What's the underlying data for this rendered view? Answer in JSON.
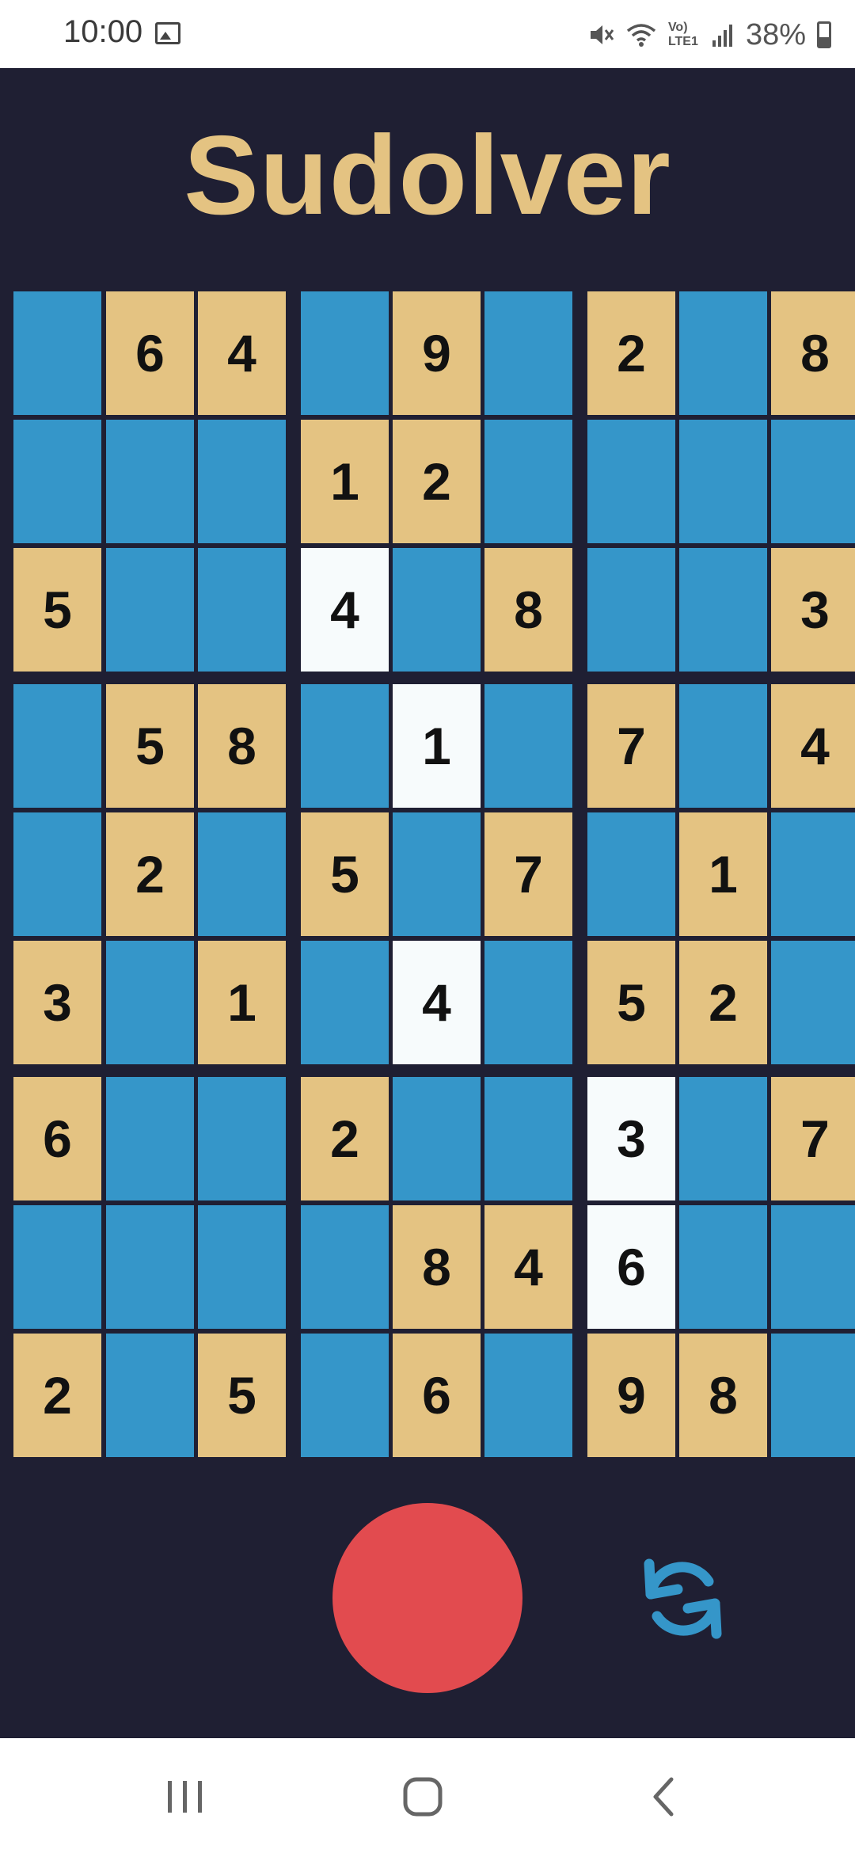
{
  "status_bar": {
    "time": "10:00",
    "network_label": "Vo) LTE1",
    "battery": "38%"
  },
  "app": {
    "title": "Sudolver"
  },
  "colors": {
    "background": "#1f1f33",
    "title": "#e4c382",
    "cell_empty": "#3596c9",
    "cell_given": "#e4c382",
    "cell_highlight": "#f7fbfc",
    "record_button": "#e24b4f",
    "refresh_icon": "#3596c9"
  },
  "board": {
    "rows": [
      [
        {
          "v": "",
          "s": "blue"
        },
        {
          "v": "6",
          "s": "tan"
        },
        {
          "v": "4",
          "s": "tan"
        },
        {
          "v": "",
          "s": "blue"
        },
        {
          "v": "9",
          "s": "tan"
        },
        {
          "v": "",
          "s": "blue"
        },
        {
          "v": "2",
          "s": "tan"
        },
        {
          "v": "",
          "s": "blue"
        },
        {
          "v": "8",
          "s": "tan"
        }
      ],
      [
        {
          "v": "",
          "s": "blue"
        },
        {
          "v": "",
          "s": "blue"
        },
        {
          "v": "",
          "s": "blue"
        },
        {
          "v": "1",
          "s": "tan"
        },
        {
          "v": "2",
          "s": "tan"
        },
        {
          "v": "",
          "s": "blue"
        },
        {
          "v": "",
          "s": "blue"
        },
        {
          "v": "",
          "s": "blue"
        },
        {
          "v": "",
          "s": "blue"
        }
      ],
      [
        {
          "v": "5",
          "s": "tan"
        },
        {
          "v": "",
          "s": "blue"
        },
        {
          "v": "",
          "s": "blue"
        },
        {
          "v": "4",
          "s": "white"
        },
        {
          "v": "",
          "s": "blue"
        },
        {
          "v": "8",
          "s": "tan"
        },
        {
          "v": "",
          "s": "blue"
        },
        {
          "v": "",
          "s": "blue"
        },
        {
          "v": "3",
          "s": "tan"
        }
      ],
      [
        {
          "v": "",
          "s": "blue"
        },
        {
          "v": "5",
          "s": "tan"
        },
        {
          "v": "8",
          "s": "tan"
        },
        {
          "v": "",
          "s": "blue"
        },
        {
          "v": "1",
          "s": "white"
        },
        {
          "v": "",
          "s": "blue"
        },
        {
          "v": "7",
          "s": "tan"
        },
        {
          "v": "",
          "s": "blue"
        },
        {
          "v": "4",
          "s": "tan"
        }
      ],
      [
        {
          "v": "",
          "s": "blue"
        },
        {
          "v": "2",
          "s": "tan"
        },
        {
          "v": "",
          "s": "blue"
        },
        {
          "v": "5",
          "s": "tan"
        },
        {
          "v": "",
          "s": "blue"
        },
        {
          "v": "7",
          "s": "tan"
        },
        {
          "v": "",
          "s": "blue"
        },
        {
          "v": "1",
          "s": "tan"
        },
        {
          "v": "",
          "s": "blue"
        }
      ],
      [
        {
          "v": "3",
          "s": "tan"
        },
        {
          "v": "",
          "s": "blue"
        },
        {
          "v": "1",
          "s": "tan"
        },
        {
          "v": "",
          "s": "blue"
        },
        {
          "v": "4",
          "s": "white"
        },
        {
          "v": "",
          "s": "blue"
        },
        {
          "v": "5",
          "s": "tan"
        },
        {
          "v": "2",
          "s": "tan"
        },
        {
          "v": "",
          "s": "blue"
        }
      ],
      [
        {
          "v": "6",
          "s": "tan"
        },
        {
          "v": "",
          "s": "blue"
        },
        {
          "v": "",
          "s": "blue"
        },
        {
          "v": "2",
          "s": "tan"
        },
        {
          "v": "",
          "s": "blue"
        },
        {
          "v": "",
          "s": "blue"
        },
        {
          "v": "3",
          "s": "white"
        },
        {
          "v": "",
          "s": "blue"
        },
        {
          "v": "7",
          "s": "tan"
        }
      ],
      [
        {
          "v": "",
          "s": "blue"
        },
        {
          "v": "",
          "s": "blue"
        },
        {
          "v": "",
          "s": "blue"
        },
        {
          "v": "",
          "s": "blue"
        },
        {
          "v": "8",
          "s": "tan"
        },
        {
          "v": "4",
          "s": "tan"
        },
        {
          "v": "6",
          "s": "white"
        },
        {
          "v": "",
          "s": "blue"
        },
        {
          "v": "",
          "s": "blue"
        }
      ],
      [
        {
          "v": "2",
          "s": "tan"
        },
        {
          "v": "",
          "s": "blue"
        },
        {
          "v": "5",
          "s": "tan"
        },
        {
          "v": "",
          "s": "blue"
        },
        {
          "v": "6",
          "s": "tan"
        },
        {
          "v": "",
          "s": "blue"
        },
        {
          "v": "9",
          "s": "tan"
        },
        {
          "v": "8",
          "s": "tan"
        },
        {
          "v": "",
          "s": "blue"
        }
      ]
    ]
  },
  "controls": {
    "record_icon": "record-circle",
    "refresh_icon": "refresh-arrows"
  },
  "nav": {
    "recent_icon": "recent-apps-icon",
    "home_icon": "home-icon",
    "back_icon": "back-icon"
  }
}
